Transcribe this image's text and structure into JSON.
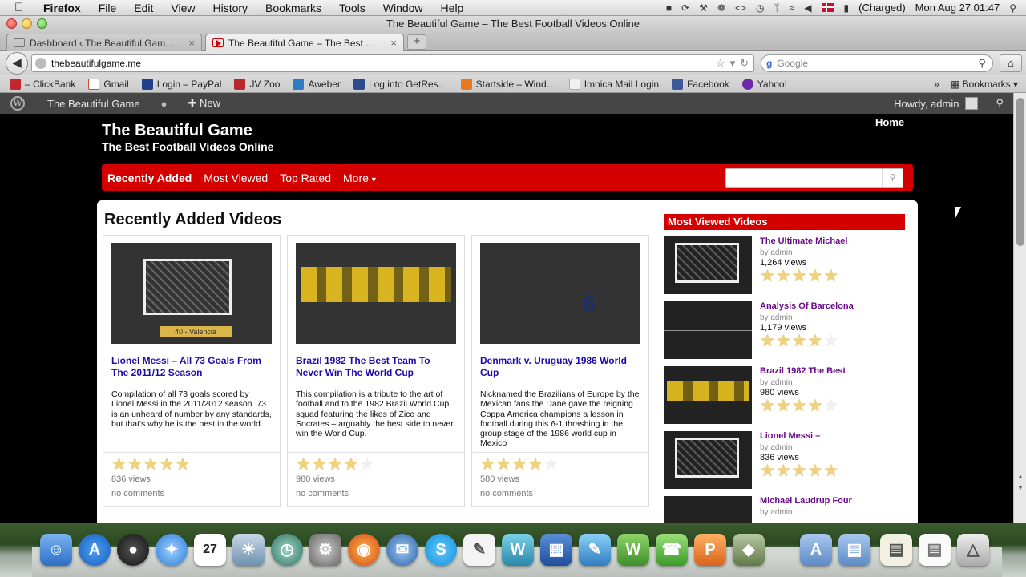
{
  "menubar": {
    "app": "Firefox",
    "items": [
      "File",
      "Edit",
      "View",
      "History",
      "Bookmarks",
      "Tools",
      "Window",
      "Help"
    ],
    "battery": "(Charged)",
    "clock": "Mon Aug 27  01:47"
  },
  "browser": {
    "window_title": "The Beautiful Game – The Best Football Videos Online",
    "tabs": [
      {
        "label": "Dashboard ‹ The Beautiful Gam…"
      },
      {
        "label": "The Beautiful Game – The Best …"
      }
    ],
    "url": "thebeautifulgame.me",
    "search_engine": "Google",
    "search_placeholder": "Google"
  },
  "bookmarks": {
    "items": [
      {
        "label": "– ClickBank",
        "color": "#c0282d"
      },
      {
        "label": "Gmail",
        "color": "#d44638"
      },
      {
        "label": "Login – PayPal",
        "color": "#1f3f8a"
      },
      {
        "label": "JV Zoo",
        "color": "#b8272c"
      },
      {
        "label": "Aweber",
        "color": "#2e7bc4"
      },
      {
        "label": "Log into GetRes…",
        "color": "#2a4b8d"
      },
      {
        "label": "Startside – Wind…",
        "color": "#e87722"
      },
      {
        "label": "Imnica Mail Login",
        "color": "#f0f0f0"
      },
      {
        "label": "Facebook",
        "color": "#3b5998"
      },
      {
        "label": "Yahoo!",
        "color": "#6e2aa6"
      }
    ],
    "overflow": "»",
    "bookmarks_menu": "Bookmarks"
  },
  "wpbar": {
    "site": "The Beautiful Game",
    "new": "New",
    "howdy": "Howdy, admin"
  },
  "site": {
    "title": "The Beautiful Game",
    "tagline": "The Best Football Videos Online",
    "home": "Home",
    "nav": [
      {
        "label": "Recently Added"
      },
      {
        "label": "Most Viewed"
      },
      {
        "label": "Top Rated"
      },
      {
        "label": "More"
      }
    ]
  },
  "main": {
    "section_title": "Recently Added Videos",
    "videos": [
      {
        "title": "Lionel Messi – All 73 Goals From The 2011/12 Season",
        "description": "Compilation of all 73 goals scored by Lionel Messi in the 2011/2012 season. 73 is an unheard of number by any standards, but that's why he is the best in the world.",
        "rating": 5,
        "views": "836 views",
        "comments": "no comments",
        "thumb_caption": "40 - Valencia"
      },
      {
        "title": "Brazil 1982 The Best Team To Never Win The World Cup",
        "description": "This compilation is a tribute to the art of football and to the 1982 Brazil World Cup squad featuring the likes of Zico and Socrates – arguably the best side to never win the World Cup.",
        "rating": 4,
        "views": "980 views",
        "comments": "no comments"
      },
      {
        "title": "Denmark v. Uruguay 1986 World Cup",
        "description": "Nicknamed the Brazilians of Europe by the Mexican fans the Dane gave the reigning Coppa America champions a lesson in football during this 6-1 thrashing in the group stage of the 1986 world cup in Mexico",
        "rating": 4,
        "views": "580 views",
        "comments": "no comments"
      }
    ]
  },
  "sidebar": {
    "heading": "Most Viewed Videos",
    "items": [
      {
        "title": "The Ultimate Michael",
        "by": "by admin",
        "views": "1,264 views",
        "rating": 5
      },
      {
        "title": "Analysis Of Barcelona",
        "by": "by admin",
        "views": "1,179 views",
        "rating": 4
      },
      {
        "title": "Brazil 1982 The Best",
        "by": "by admin",
        "views": "980 views",
        "rating": 4
      },
      {
        "title": "Lionel Messi –",
        "by": "by admin",
        "views": "836 views",
        "rating": 5
      },
      {
        "title": "Michael Laudrup Four",
        "by": "by admin",
        "views": "",
        "rating": 0
      }
    ]
  },
  "dock": {
    "calendar_day": "27"
  }
}
